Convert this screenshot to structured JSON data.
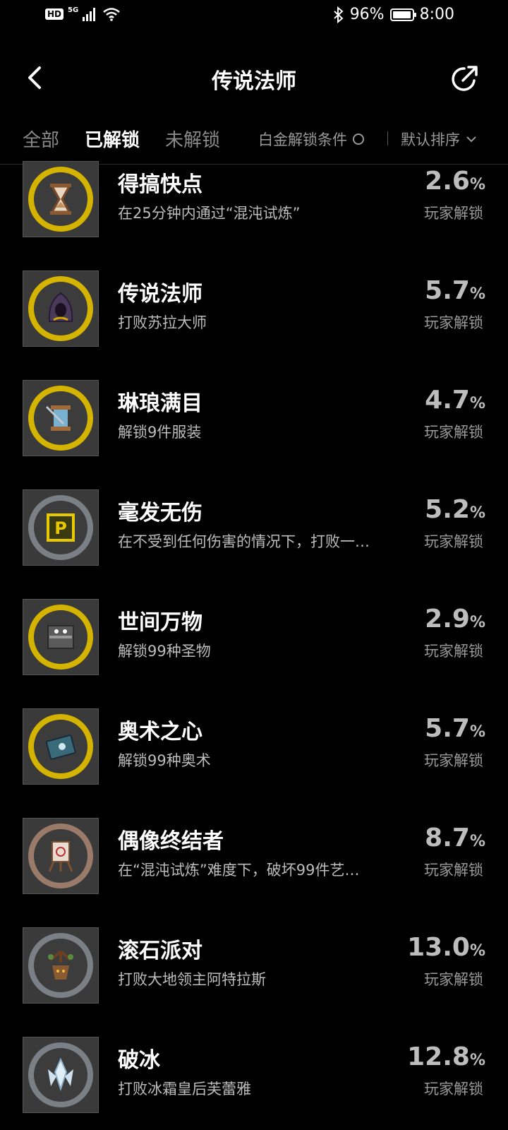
{
  "status_bar": {
    "hd": "HD",
    "network": "5G",
    "battery_pct": "96%",
    "battery_level": 0.96,
    "time": "8:00"
  },
  "header": {
    "title": "传说法师"
  },
  "filters": {
    "tabs": [
      "全部",
      "已解锁",
      "未解锁"
    ],
    "active_tab": "已解锁",
    "platinum": "白金解锁条件",
    "sort": "默认排序"
  },
  "achievements": [
    {
      "title": "得搞快点",
      "desc": "在25分钟内通过“混沌试炼”",
      "pct": "2.6",
      "label": "玩家解锁",
      "icon": "hourglass-icon",
      "ring": "#d4b400"
    },
    {
      "title": "传说法师",
      "desc": "打败苏拉大师",
      "pct": "5.7",
      "label": "玩家解锁",
      "icon": "hooded-mage-icon",
      "ring": "#d4b400"
    },
    {
      "title": "琳琅满目",
      "desc": "解锁9件服装",
      "pct": "4.7",
      "label": "玩家解锁",
      "icon": "thread-spool-icon",
      "ring": "#d4b400"
    },
    {
      "title": "毫发无伤",
      "desc": "在不受到任何伤害的情况下，打败一…",
      "pct": "5.2",
      "label": "玩家解锁",
      "icon": "p-sign-icon",
      "ring": "#7b8086"
    },
    {
      "title": "世间万物",
      "desc": "解锁99种圣物",
      "pct": "2.9",
      "label": "玩家解锁",
      "icon": "relic-shelf-icon",
      "ring": "#d4b400"
    },
    {
      "title": "奥术之心",
      "desc": "解锁99种奥术",
      "pct": "5.7",
      "label": "玩家解锁",
      "icon": "spellbook-icon",
      "ring": "#d4b400"
    },
    {
      "title": "偶像终结者",
      "desc": "在“混沌试炼”难度下，破坏99件艺…",
      "pct": "8.7",
      "label": "玩家解锁",
      "icon": "easel-icon",
      "ring": "#9a7a68"
    },
    {
      "title": "滚石派对",
      "desc": "打败大地领主阿特拉斯",
      "pct": "13.0",
      "label": "玩家解锁",
      "icon": "tree-lord-icon",
      "ring": "#7b8086"
    },
    {
      "title": "破冰",
      "desc": "打败冰霜皇后芙蕾雅",
      "pct": "12.8",
      "label": "玩家解锁",
      "icon": "ice-crystal-icon",
      "ring": "#7b8086"
    }
  ]
}
